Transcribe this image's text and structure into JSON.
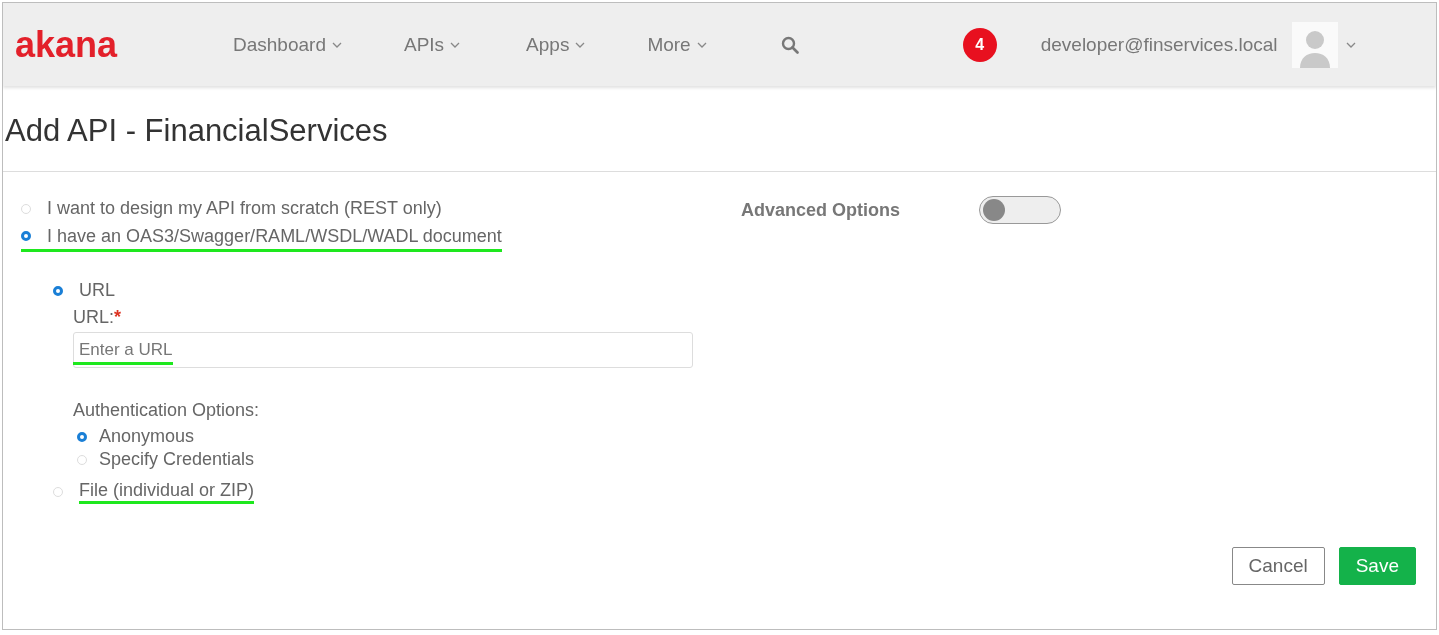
{
  "header": {
    "logo": "akana",
    "nav": [
      {
        "label": "Dashboard"
      },
      {
        "label": "APIs"
      },
      {
        "label": "Apps"
      },
      {
        "label": "More"
      }
    ],
    "notification_count": "4",
    "user": "developer@finservices.local"
  },
  "page_title": "Add API - FinancialServices",
  "source_options": [
    {
      "label": "I want to design my API from scratch (REST only)",
      "selected": false,
      "highlighted": false
    },
    {
      "label": "I have an OAS3/Swagger/RAML/WSDL/WADL document",
      "selected": true,
      "highlighted": true
    }
  ],
  "url_option": {
    "label": "URL",
    "selected": true
  },
  "url_field": {
    "label": "URL:",
    "required_mark": "*",
    "placeholder": "Enter a URL",
    "highlighted": true
  },
  "authentication": {
    "label": "Authentication Options:",
    "options": [
      {
        "label": "Anonymous",
        "selected": true
      },
      {
        "label": "Specify Credentials",
        "selected": false
      }
    ]
  },
  "file_option": {
    "label": "File (individual or ZIP)",
    "selected": false,
    "highlighted": true
  },
  "advanced_options": {
    "label": "Advanced Options",
    "on": false
  },
  "buttons": [
    {
      "kind": "secondary",
      "label": "Cancel"
    },
    {
      "kind": "primary",
      "label": "Save"
    }
  ]
}
